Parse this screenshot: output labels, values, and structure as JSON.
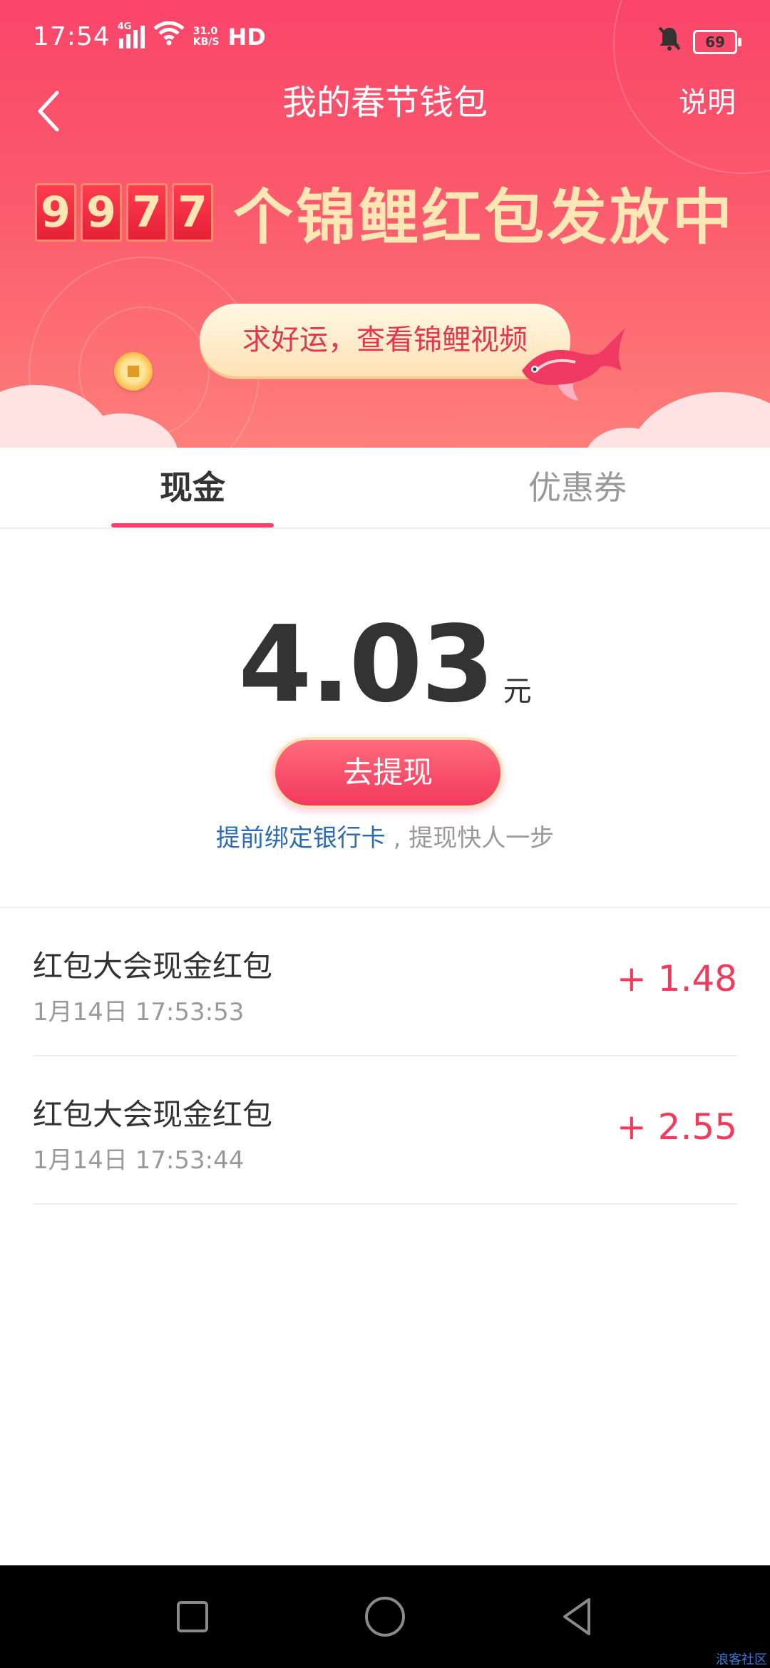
{
  "status_bar": {
    "time": "17:54",
    "network": "4G",
    "speed_value": "31.0",
    "speed_unit": "KB/S",
    "hd": "HD",
    "battery": "69"
  },
  "header": {
    "title": "我的春节钱包",
    "help_label": "说明",
    "counter_digits": [
      "9",
      "9",
      "7",
      "7"
    ],
    "counter_text": "个锦鲤红包发放中",
    "lucky_button": "求好运，查看锦鲤视频"
  },
  "tabs": {
    "cash": "现金",
    "coupon": "优惠券",
    "active": "cash"
  },
  "balance": {
    "amount": "4.03",
    "unit": "元",
    "withdraw_label": "去提现",
    "bind_link": "提前绑定银行卡",
    "bind_suffix": " , 提现快人一步"
  },
  "records": [
    {
      "title": "红包大会现金红包",
      "time": "1月14日 17:53:53",
      "amount": "+ 1.48"
    },
    {
      "title": "红包大会现金红包",
      "time": "1月14日 17:53:44",
      "amount": "+ 2.55"
    }
  ],
  "colors": {
    "brand": "#f9456a",
    "accent": "#f23a5c",
    "link": "#2e6bb6"
  },
  "icons": {
    "back": "chevron-left-icon",
    "mute": "bell-off-icon",
    "wifi": "wifi-icon",
    "nav_recent": "square-icon",
    "nav_home": "circle-icon",
    "nav_back": "triangle-left-icon"
  },
  "watermark": "浪客社区"
}
